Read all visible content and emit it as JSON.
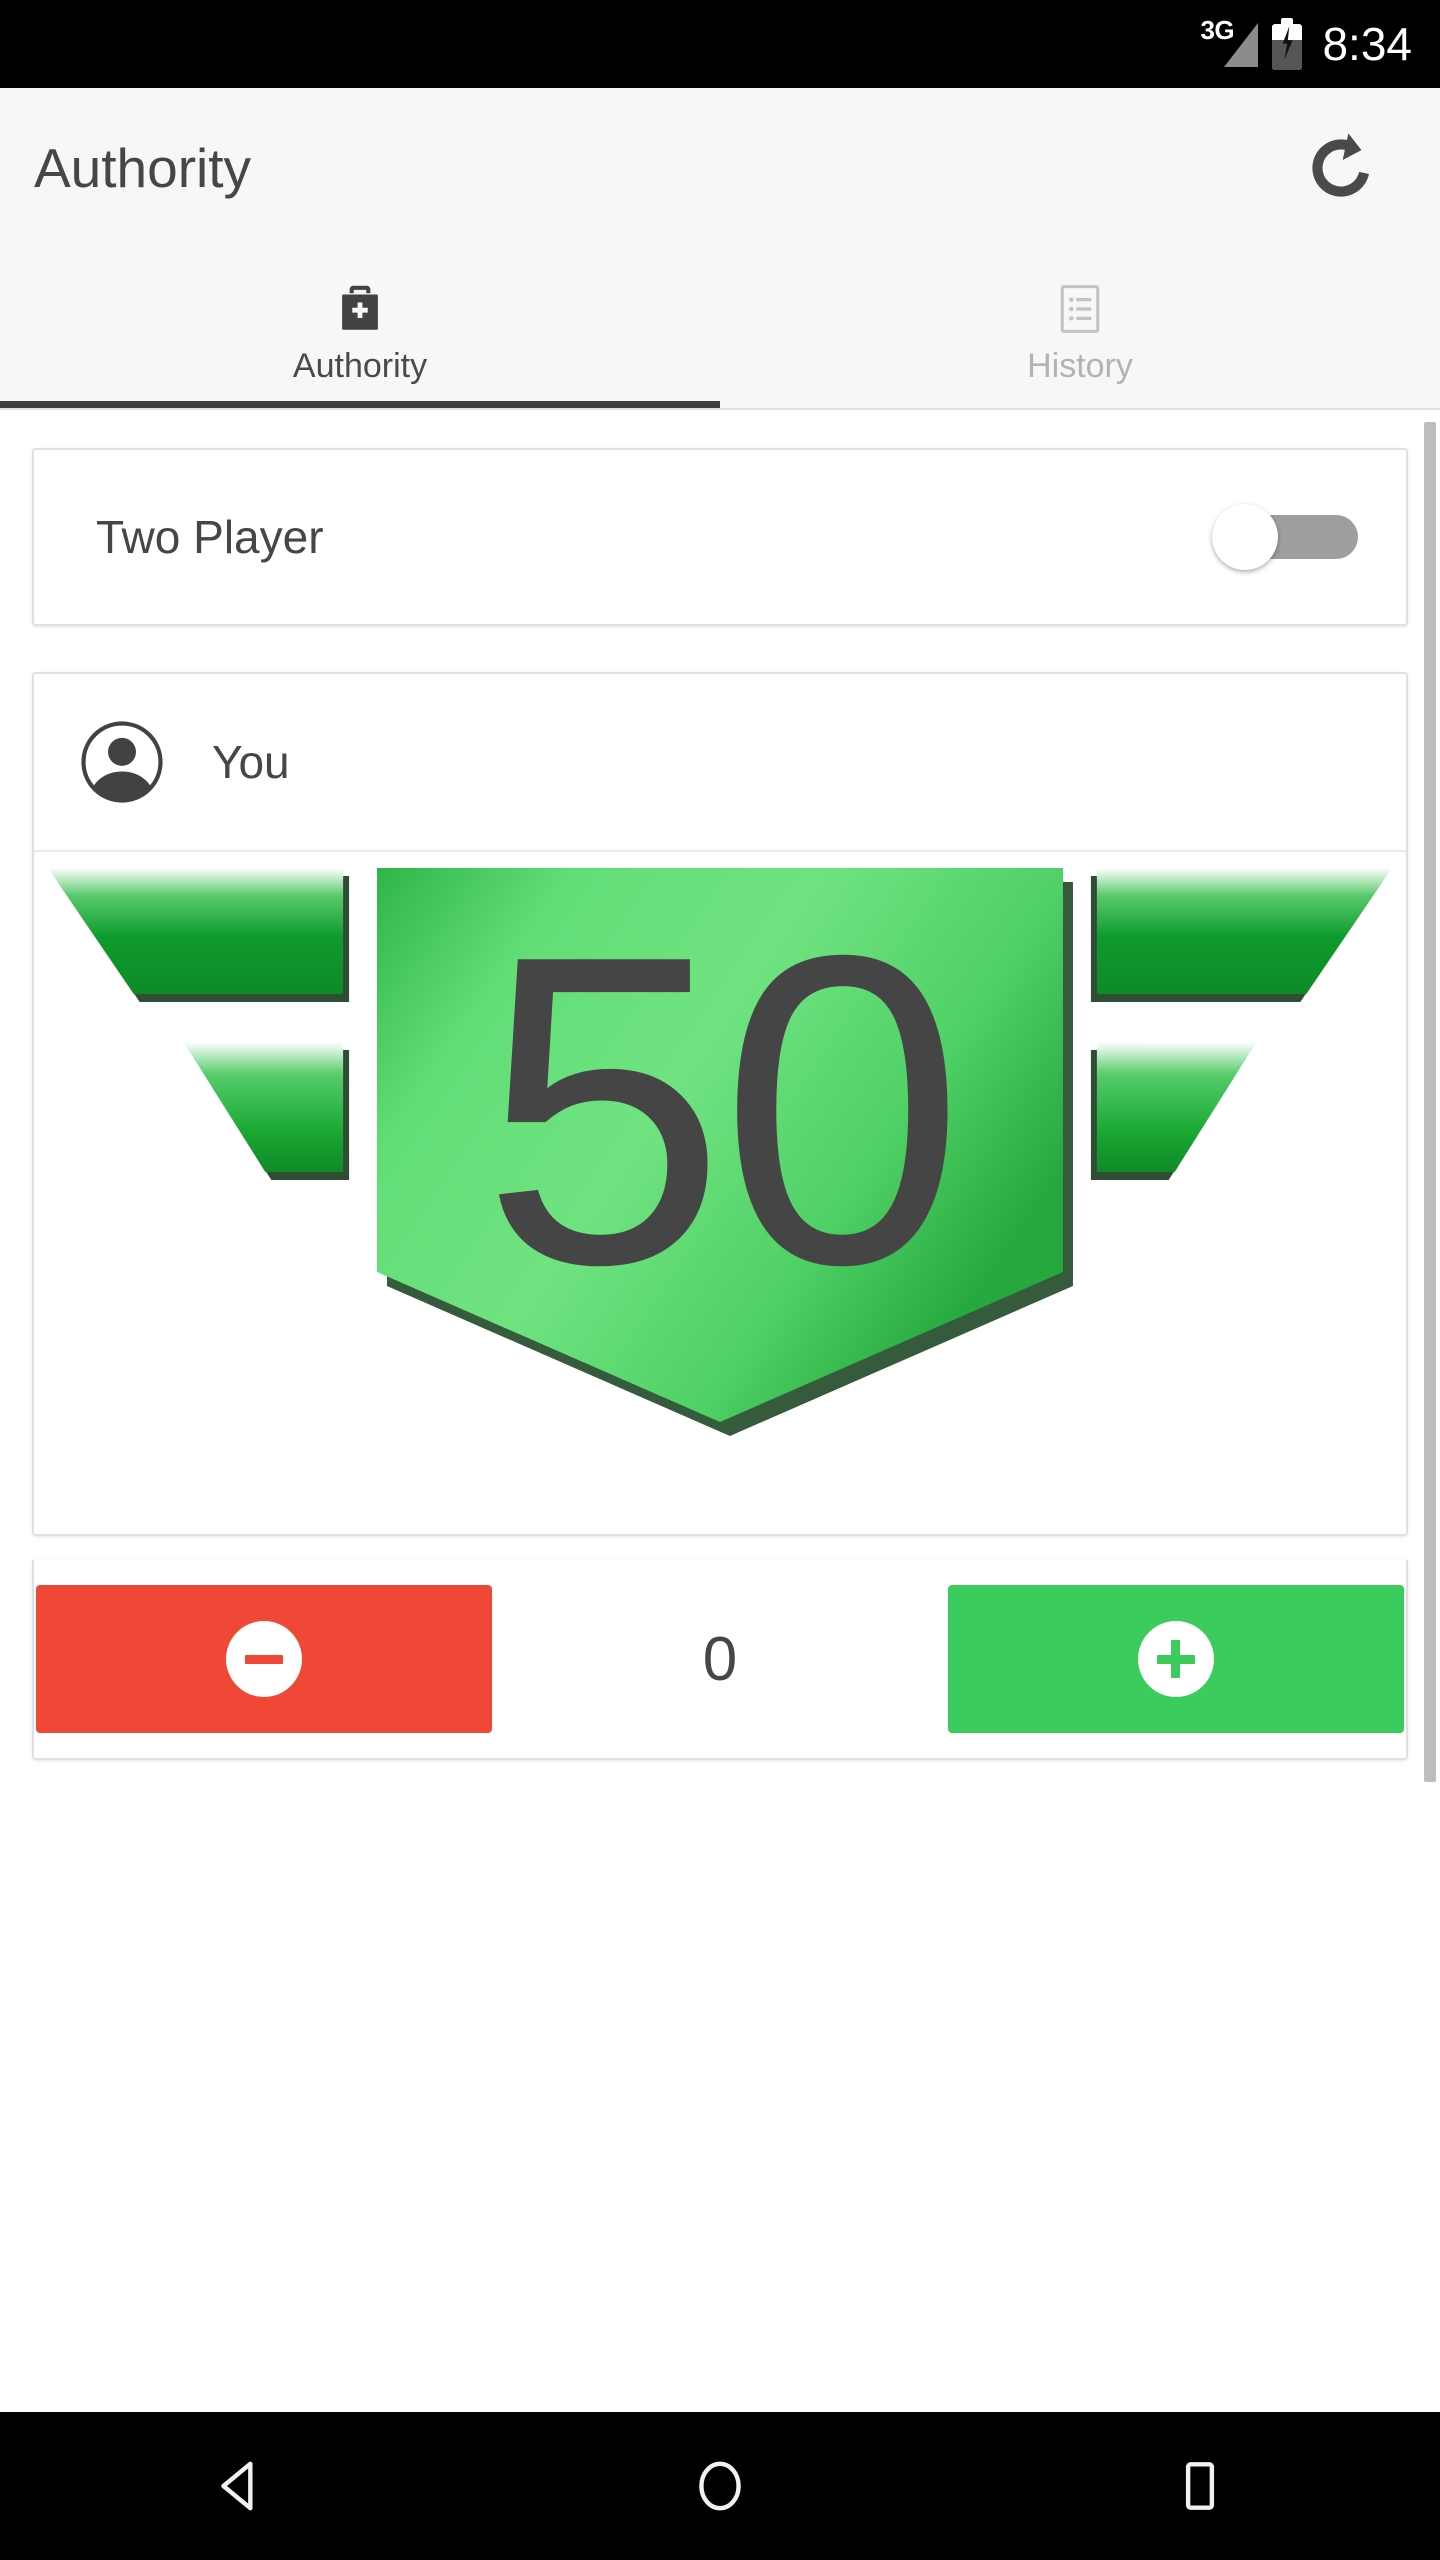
{
  "status_bar": {
    "network_label": "3G",
    "time": "8:34",
    "signal_icon": "signal-triangle-icon",
    "battery_icon": "battery-charging-icon"
  },
  "app_bar": {
    "title": "Authority",
    "refresh_icon": "refresh-icon"
  },
  "tabs": [
    {
      "label": "Authority",
      "icon": "medical-kit-icon",
      "active": true
    },
    {
      "label": "History",
      "icon": "list-icon",
      "active": false
    }
  ],
  "settings_card": {
    "label": "Two Player",
    "toggle_state": "off"
  },
  "player_card": {
    "avatar_icon": "person-avatar-icon",
    "name": "You",
    "authority_value": "50",
    "shield_color_light": "#6ee27f",
    "shield_color_dark": "#1faa3c",
    "value_text_color": "#454545"
  },
  "counter_row": {
    "decrement_label": "minus-icon",
    "increment_label": "plus-icon",
    "delta_value": "0",
    "decrement_color": "#ef4836",
    "increment_color": "#3ccb5d"
  },
  "nav_bar": {
    "back_icon": "back-triangle-icon",
    "home_icon": "home-circle-icon",
    "recents_icon": "recents-square-icon"
  }
}
